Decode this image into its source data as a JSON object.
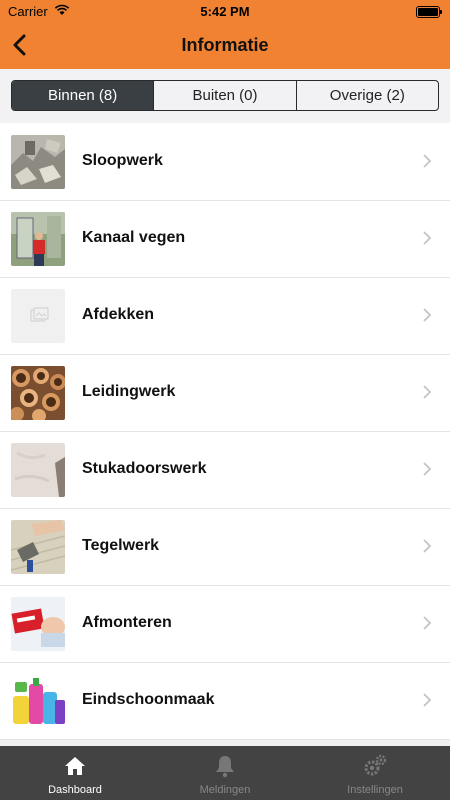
{
  "status_bar": {
    "carrier": "Carrier",
    "time": "5:42 PM"
  },
  "header": {
    "title": "Informatie",
    "back_icon": "chevron-left-icon"
  },
  "segments": [
    {
      "label": "Binnen (8)",
      "selected": true
    },
    {
      "label": "Buiten (0)",
      "selected": false
    },
    {
      "label": "Overige (2)",
      "selected": false
    }
  ],
  "items": [
    {
      "label": "Sloopwerk",
      "icon": "rubble-photo"
    },
    {
      "label": "Kanaal vegen",
      "icon": "worker-photo"
    },
    {
      "label": "Afdekken",
      "icon": "image-placeholder-icon"
    },
    {
      "label": "Leidingwerk",
      "icon": "pipes-photo"
    },
    {
      "label": "Stukadoorswerk",
      "icon": "plaster-photo"
    },
    {
      "label": "Tegelwerk",
      "icon": "tiling-photo"
    },
    {
      "label": "Afmonteren",
      "icon": "assembly-photo"
    },
    {
      "label": "Eindschoonmaak",
      "icon": "cleaning-supplies-photo"
    }
  ],
  "tabbar": [
    {
      "label": "Dashboard",
      "icon": "home-icon",
      "active": true
    },
    {
      "label": "Meldingen",
      "icon": "bell-icon",
      "active": false
    },
    {
      "label": "Instellingen",
      "icon": "gears-icon",
      "active": false
    }
  ],
  "colors": {
    "accent": "#f08232",
    "tabbar": "#434343",
    "segment_selected": "#3a3f44"
  }
}
